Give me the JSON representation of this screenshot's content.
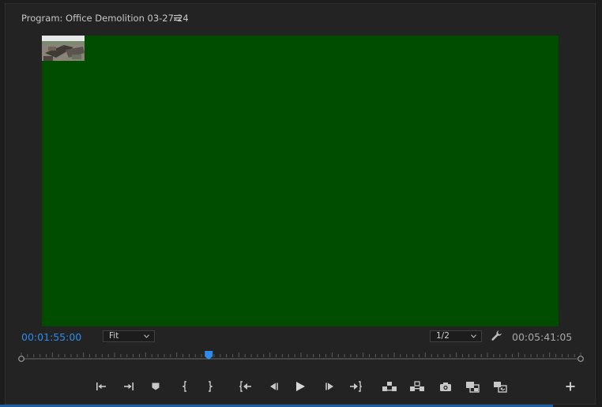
{
  "panel": {
    "title": "Program: Office Demolition 03-27-24",
    "menu_icon": "hamburger-icon"
  },
  "viewer": {
    "frame_color": "#004d00",
    "thumbnail": "aerial-site-thumbnail"
  },
  "status_bar": {
    "current_timecode": "00:01:55:00",
    "zoom": "Fit",
    "resolution": "1/2",
    "duration": "00:05:41:05",
    "settings_icon": "wrench-icon"
  },
  "timeline": {
    "playhead_fraction": 0.335
  },
  "controls": [
    "mark-in-icon",
    "mark-out-icon",
    "add-marker-icon",
    "go-to-in-icon",
    "go-to-out-icon",
    "step-back-to-in-icon",
    "step-back-icon",
    "play-icon",
    "step-forward-icon",
    "step-forward-to-out-icon",
    "lift-icon",
    "extract-icon",
    "export-frame-icon",
    "comparison-view-icon",
    "toggle-proxies-icon",
    "add-button-icon"
  ],
  "colors": {
    "accent": "#2d8ceb",
    "panel_bg": "#232323",
    "text": "#c7c7c7"
  }
}
